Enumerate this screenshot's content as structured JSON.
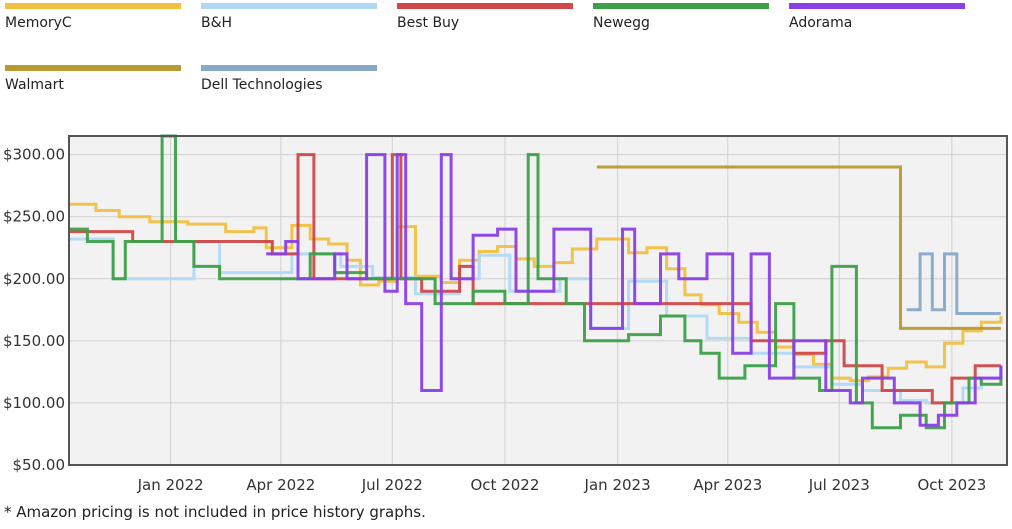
{
  "chart_data": {
    "type": "line",
    "legend_position": "top",
    "grid": true,
    "x_ticks": [
      "Jan 2022",
      "Apr 2022",
      "Jul 2022",
      "Oct 2022",
      "Jan 2023",
      "Apr 2023",
      "Jul 2023",
      "Oct 2023"
    ],
    "y_ticks": [
      "$300.00",
      "$250.00",
      "$200.00",
      "$150.00",
      "$100.00",
      "$50.00"
    ],
    "xlim": [
      "2021-10-10",
      "2023-11-15"
    ],
    "ylim": [
      50,
      315
    ],
    "series": [
      {
        "name": "MemoryC",
        "color": "#f0c040",
        "points": [
          [
            "2021-10-10",
            260
          ],
          [
            "2021-11-01",
            255
          ],
          [
            "2021-11-20",
            250
          ],
          [
            "2021-12-15",
            246
          ],
          [
            "2022-01-15",
            244
          ],
          [
            "2022-02-15",
            238
          ],
          [
            "2022-03-10",
            241
          ],
          [
            "2022-03-20",
            225
          ],
          [
            "2022-04-10",
            243
          ],
          [
            "2022-04-25",
            232
          ],
          [
            "2022-05-10",
            228
          ],
          [
            "2022-05-25",
            215
          ],
          [
            "2022-06-05",
            195
          ],
          [
            "2022-06-20",
            198
          ],
          [
            "2022-07-05",
            242
          ],
          [
            "2022-07-20",
            202
          ],
          [
            "2022-08-10",
            197
          ],
          [
            "2022-08-25",
            215
          ],
          [
            "2022-09-10",
            222
          ],
          [
            "2022-09-25",
            226
          ],
          [
            "2022-10-10",
            216
          ],
          [
            "2022-10-25",
            210
          ],
          [
            "2022-11-10",
            213
          ],
          [
            "2022-11-25",
            224
          ],
          [
            "2022-12-15",
            232
          ],
          [
            "2023-01-10",
            221
          ],
          [
            "2023-01-25",
            225
          ],
          [
            "2023-02-10",
            208
          ],
          [
            "2023-02-25",
            187
          ],
          [
            "2023-03-10",
            179
          ],
          [
            "2023-03-25",
            172
          ],
          [
            "2023-04-10",
            165
          ],
          [
            "2023-04-25",
            157
          ],
          [
            "2023-05-10",
            145
          ],
          [
            "2023-05-25",
            139
          ],
          [
            "2023-06-10",
            131
          ],
          [
            "2023-06-25",
            120
          ],
          [
            "2023-07-10",
            118
          ],
          [
            "2023-07-25",
            121
          ],
          [
            "2023-08-10",
            128
          ],
          [
            "2023-08-25",
            133
          ],
          [
            "2023-09-10",
            129
          ],
          [
            "2023-09-25",
            148
          ],
          [
            "2023-10-10",
            158
          ],
          [
            "2023-10-25",
            165
          ],
          [
            "2023-11-10",
            170
          ]
        ]
      },
      {
        "name": "B&H",
        "color": "#b0d8f5",
        "points": [
          [
            "2021-10-10",
            232
          ],
          [
            "2021-11-15",
            200
          ],
          [
            "2022-01-20",
            230
          ],
          [
            "2022-02-10",
            205
          ],
          [
            "2022-04-10",
            220
          ],
          [
            "2022-05-20",
            210
          ],
          [
            "2022-06-15",
            201
          ],
          [
            "2022-07-20",
            188
          ],
          [
            "2022-08-25",
            200
          ],
          [
            "2022-09-10",
            219
          ],
          [
            "2022-10-05",
            190
          ],
          [
            "2022-11-15",
            200
          ],
          [
            "2022-12-10",
            160
          ],
          [
            "2023-01-10",
            198
          ],
          [
            "2023-02-10",
            170
          ],
          [
            "2023-03-15",
            152
          ],
          [
            "2023-04-20",
            140
          ],
          [
            "2023-05-25",
            129
          ],
          [
            "2023-06-25",
            115
          ],
          [
            "2023-07-20",
            110
          ],
          [
            "2023-08-20",
            102
          ],
          [
            "2023-09-10",
            100
          ],
          [
            "2023-10-10",
            112
          ],
          [
            "2023-10-25",
            120
          ],
          [
            "2023-11-10",
            118
          ]
        ]
      },
      {
        "name": "Best Buy",
        "color": "#d04848",
        "points": [
          [
            "2021-10-10",
            238
          ],
          [
            "2021-12-01",
            230
          ],
          [
            "2022-03-25",
            220
          ],
          [
            "2022-04-15",
            300
          ],
          [
            "2022-04-28",
            200
          ],
          [
            "2022-06-20",
            200
          ],
          [
            "2022-07-01",
            300
          ],
          [
            "2022-07-08",
            200
          ],
          [
            "2022-07-25",
            190
          ],
          [
            "2022-08-25",
            210
          ],
          [
            "2022-09-05",
            180
          ],
          [
            "2023-04-20",
            150
          ],
          [
            "2023-05-25",
            140
          ],
          [
            "2023-06-20",
            150
          ],
          [
            "2023-07-05",
            130
          ],
          [
            "2023-08-05",
            110
          ],
          [
            "2023-09-15",
            100
          ],
          [
            "2023-10-01",
            120
          ],
          [
            "2023-10-20",
            130
          ],
          [
            "2023-11-10",
            130
          ]
        ]
      },
      {
        "name": "Newegg",
        "color": "#3ca048",
        "points": [
          [
            "2021-10-10",
            240
          ],
          [
            "2021-10-25",
            230
          ],
          [
            "2021-11-15",
            200
          ],
          [
            "2021-11-25",
            230
          ],
          [
            "2021-12-25",
            315
          ],
          [
            "2022-01-05",
            230
          ],
          [
            "2022-01-20",
            210
          ],
          [
            "2022-02-10",
            200
          ],
          [
            "2022-03-20",
            200
          ],
          [
            "2022-04-25",
            220
          ],
          [
            "2022-05-15",
            205
          ],
          [
            "2022-06-10",
            200
          ],
          [
            "2022-07-15",
            200
          ],
          [
            "2022-08-05",
            180
          ],
          [
            "2022-09-05",
            190
          ],
          [
            "2022-10-01",
            180
          ],
          [
            "2022-10-20",
            300
          ],
          [
            "2022-10-28",
            200
          ],
          [
            "2022-11-20",
            180
          ],
          [
            "2022-12-05",
            150
          ],
          [
            "2022-12-20",
            150
          ],
          [
            "2023-01-10",
            155
          ],
          [
            "2023-02-05",
            170
          ],
          [
            "2023-02-25",
            150
          ],
          [
            "2023-03-10",
            140
          ],
          [
            "2023-03-25",
            120
          ],
          [
            "2023-04-15",
            130
          ],
          [
            "2023-05-10",
            180
          ],
          [
            "2023-05-25",
            120
          ],
          [
            "2023-06-15",
            110
          ],
          [
            "2023-06-25",
            210
          ],
          [
            "2023-07-15",
            100
          ],
          [
            "2023-07-28",
            80
          ],
          [
            "2023-08-20",
            90
          ],
          [
            "2023-09-10",
            80
          ],
          [
            "2023-09-25",
            100
          ],
          [
            "2023-10-15",
            120
          ],
          [
            "2023-10-25",
            115
          ],
          [
            "2023-11-10",
            130
          ]
        ]
      },
      {
        "name": "Adorama",
        "color": "#8a3fe6",
        "points": [
          [
            "2022-03-20",
            220
          ],
          [
            "2022-04-05",
            230
          ],
          [
            "2022-04-15",
            200
          ],
          [
            "2022-05-15",
            220
          ],
          [
            "2022-05-25",
            200
          ],
          [
            "2022-06-10",
            300
          ],
          [
            "2022-06-25",
            190
          ],
          [
            "2022-07-05",
            300
          ],
          [
            "2022-07-12",
            180
          ],
          [
            "2022-07-25",
            110
          ],
          [
            "2022-08-10",
            300
          ],
          [
            "2022-08-18",
            200
          ],
          [
            "2022-09-05",
            235
          ],
          [
            "2022-09-25",
            240
          ],
          [
            "2022-10-10",
            190
          ],
          [
            "2022-11-10",
            240
          ],
          [
            "2022-12-10",
            160
          ],
          [
            "2023-01-05",
            240
          ],
          [
            "2023-01-15",
            180
          ],
          [
            "2023-02-05",
            220
          ],
          [
            "2023-02-20",
            200
          ],
          [
            "2023-03-15",
            220
          ],
          [
            "2023-04-05",
            140
          ],
          [
            "2023-04-20",
            220
          ],
          [
            "2023-05-05",
            120
          ],
          [
            "2023-05-25",
            150
          ],
          [
            "2023-06-20",
            110
          ],
          [
            "2023-07-10",
            100
          ],
          [
            "2023-07-20",
            120
          ],
          [
            "2023-08-15",
            100
          ],
          [
            "2023-09-05",
            82
          ],
          [
            "2023-09-20",
            90
          ],
          [
            "2023-10-05",
            100
          ],
          [
            "2023-10-20",
            120
          ],
          [
            "2023-11-10",
            130
          ]
        ]
      },
      {
        "name": "Walmart",
        "color": "#b89a30",
        "points": [
          [
            "2022-12-15",
            290
          ],
          [
            "2023-08-20",
            160
          ],
          [
            "2023-10-20",
            160
          ],
          [
            "2023-11-10",
            160
          ]
        ]
      },
      {
        "name": "Dell Technologies",
        "color": "#88a8c8",
        "points": [
          [
            "2023-08-25",
            175
          ],
          [
            "2023-09-05",
            220
          ],
          [
            "2023-09-15",
            175
          ],
          [
            "2023-09-25",
            220
          ],
          [
            "2023-10-05",
            172
          ],
          [
            "2023-11-10",
            172
          ]
        ]
      }
    ]
  },
  "footnote": "* Amazon pricing is not included in price history graphs."
}
